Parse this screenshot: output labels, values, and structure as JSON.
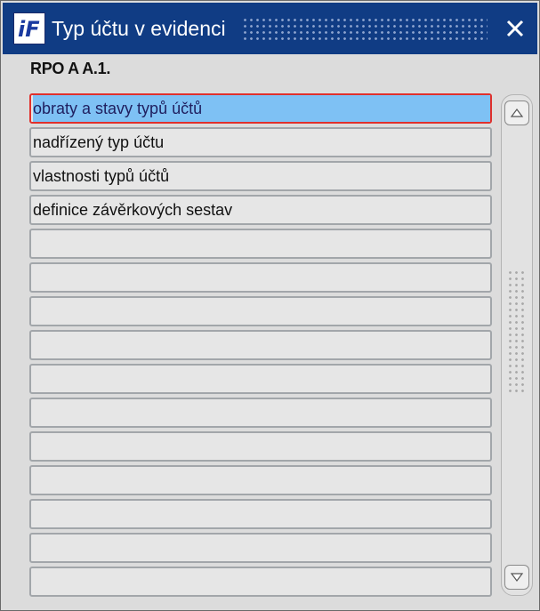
{
  "window": {
    "title": "Typ účtu v evidenci",
    "close_glyph": "✕",
    "icon": "app-logo-icon"
  },
  "section": {
    "label": "RPO A A.1."
  },
  "list": {
    "items": [
      {
        "label": "obraty a stavy typů účtů",
        "selected": true
      },
      {
        "label": "nadřízený typ účtu",
        "selected": false
      },
      {
        "label": "vlastnosti typů účtů",
        "selected": false
      },
      {
        "label": "definice závěrkových sestav",
        "selected": false
      },
      {
        "label": "",
        "selected": false
      },
      {
        "label": "",
        "selected": false
      },
      {
        "label": "",
        "selected": false
      },
      {
        "label": "",
        "selected": false
      },
      {
        "label": "",
        "selected": false
      },
      {
        "label": "",
        "selected": false
      },
      {
        "label": "",
        "selected": false
      },
      {
        "label": "",
        "selected": false
      },
      {
        "label": "",
        "selected": false
      },
      {
        "label": "",
        "selected": false
      },
      {
        "label": "",
        "selected": false
      }
    ]
  },
  "colors": {
    "titlebar": "#103c84",
    "selection": "#7ec1f4",
    "focus_border": "#e0302c"
  }
}
